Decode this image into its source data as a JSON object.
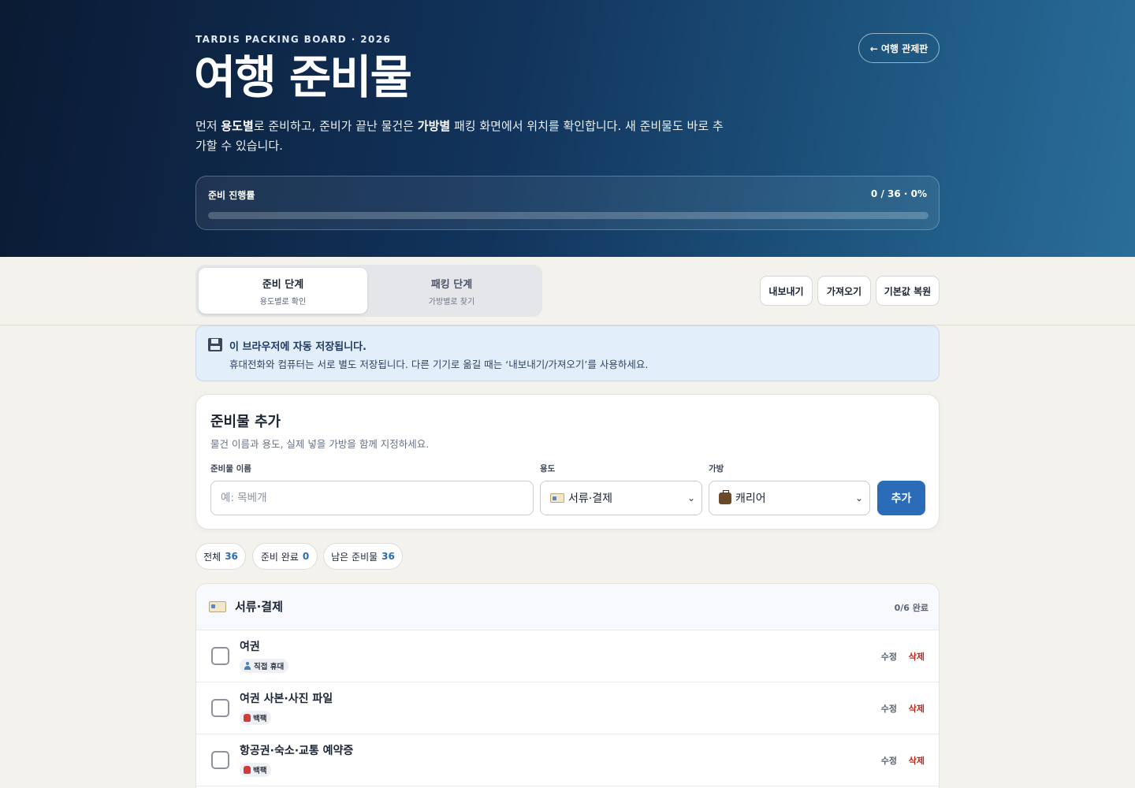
{
  "hero": {
    "kicker": "TARDIS PACKING BOARD · 2026",
    "title": "여행 준비물",
    "desc_parts": [
      "먼저 ",
      "용도별",
      "로 준비하고, 준비가 끝난 물건은 ",
      "가방별",
      " 패킹 화면에서 위치를 확인합니다. 새 준비물도 바로 추가할 수 있습니다."
    ],
    "control_button": "← 여행 관제판",
    "progress": {
      "label": "준비 진행률",
      "value_text": "0 / 36 · 0%",
      "fraction": 0
    }
  },
  "tabs": [
    {
      "label": "준비 단계",
      "sub": "용도별로 확인",
      "active": true
    },
    {
      "label": "패킹 단계",
      "sub": "가방별로 찾기",
      "active": false
    }
  ],
  "actions": {
    "export": "내보내기",
    "import": "가져오기",
    "reset": "기본값 복원"
  },
  "info": {
    "title": "이 브라우저에 자동 저장됩니다.",
    "text": "휴대전화와 컴퓨터는 서로 별도 저장됩니다. 다른 기기로 옮길 때는 ‘내보내기/가져오기’를 사용하세요."
  },
  "add_form": {
    "title": "준비물 추가",
    "subtitle": "물건 이름과 용도, 실제 넣을 가방을 함께 지정하세요.",
    "name_label": "준비물 이름",
    "name_placeholder": "예: 목베개",
    "use_label": "용도",
    "use_value": "서류·결제",
    "bag_label": "가방",
    "bag_value": "캐리어",
    "submit": "추가"
  },
  "filters": [
    {
      "label": "전체",
      "count": "36"
    },
    {
      "label": "준비 완료",
      "count": "0"
    },
    {
      "label": "남은 준비물",
      "count": "36"
    }
  ],
  "category": {
    "title": "서류·결제",
    "count": "0/6 완료",
    "items": [
      {
        "name": "여권",
        "tag": "직접 휴대",
        "tag_icon": "person-icon"
      },
      {
        "name": "여권 사본·사진 파일",
        "tag": "백팩",
        "tag_icon": "backpack-icon"
      },
      {
        "name": "항공권·숙소·교통 예약증",
        "tag": "백팩",
        "tag_icon": "backpack-icon"
      }
    ],
    "edit_label": "수정",
    "delete_label": "삭제"
  },
  "colors": {
    "accent": "#2a6cb8",
    "danger": "#c2261c",
    "hero_dark": "#0a1a33",
    "hero_light": "#2a6e98"
  }
}
